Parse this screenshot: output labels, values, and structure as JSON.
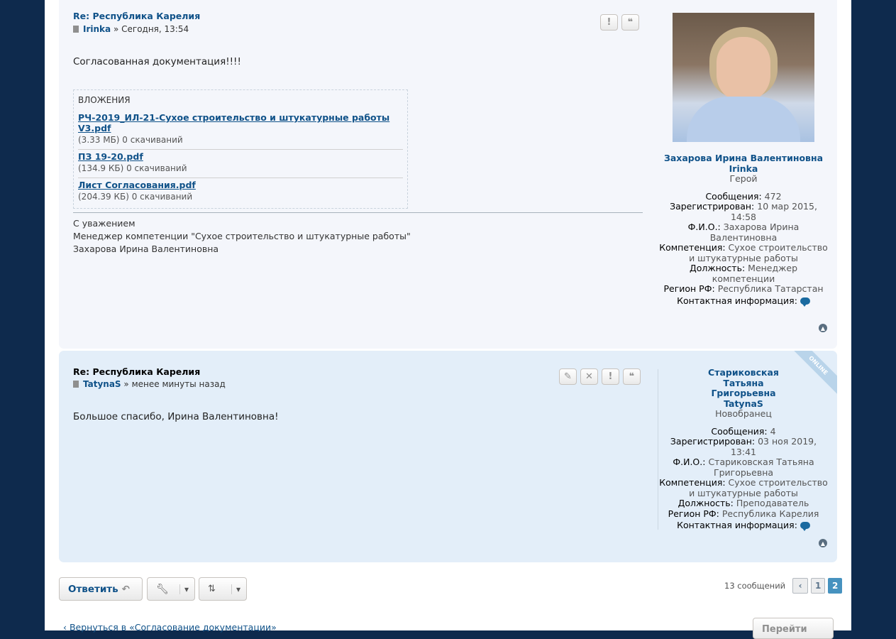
{
  "posts": [
    {
      "title": "Re: Республика Карелия",
      "author": "Irinka",
      "sep": "»",
      "time": "Сегодня, 13:54",
      "body": "Согласованная документация!!!!",
      "buttons": [
        "!",
        "❝"
      ],
      "attachments_heading": "ВЛОЖЕНИЯ",
      "attachments": [
        {
          "name": "РЧ-2019_ИЛ-21-Сухое строительство и штукатурные работы V3.pdf",
          "info": "(3.33 МБ) 0 скачиваний"
        },
        {
          "name": "ПЗ 19-20.pdf",
          "info": "(134.9 КБ) 0 скачиваний"
        },
        {
          "name": "Лист Согласования.pdf",
          "info": "(204.39 КБ) 0 скачиваний"
        }
      ],
      "signature": [
        "С уважением",
        "Менеджер компетенции \"Сухое строительство и штукатурные работы\"",
        "Захарова Ирина Валентиновна"
      ],
      "profile": {
        "fullname": "Захарова Ирина Валентиновна",
        "username": "Irinka",
        "rank": "Герой",
        "fields": [
          {
            "k": "Сообщения:",
            "v": "472"
          },
          {
            "k": "Зарегистрирован:",
            "v": "10 мар 2015, 14:58"
          },
          {
            "k": "Ф.И.О.:",
            "v": "Захарова Ирина Валентиновна"
          },
          {
            "k": "Компетенция:",
            "v": "Сухое строительство и штукатурные работы"
          },
          {
            "k": "Должность:",
            "v": "Менеджер компетенции"
          },
          {
            "k": "Регион РФ:",
            "v": "Республика Татарстан"
          }
        ],
        "contact_label": "Контактная информация:"
      }
    },
    {
      "title": "Re: Республика Карелия",
      "author": "TatynaS",
      "sep": "»",
      "time": "менее минуты назад",
      "body": "Большое спасибо, Ирина Валентиновна!",
      "buttons": [
        "✎",
        "✕",
        "!",
        "❝"
      ],
      "online_label": "ONLINE",
      "profile": {
        "fullname": "Стариковская Татьяна Григорьевна",
        "username": "TatynaS",
        "rank": "Новобранец",
        "fields": [
          {
            "k": "Сообщения:",
            "v": "4"
          },
          {
            "k": "Зарегистрирован:",
            "v": "03 ноя 2019, 13:41"
          },
          {
            "k": "Ф.И.О.:",
            "v": "Стариковская Татьяна Григорьевна"
          },
          {
            "k": "Компетенция:",
            "v": "Сухое строительство и штукатурные работы"
          },
          {
            "k": "Должность:",
            "v": "Преподаватель"
          },
          {
            "k": "Регион РФ:",
            "v": "Республика Карелия"
          }
        ],
        "contact_label": "Контактная информация:"
      }
    }
  ],
  "actions": {
    "reply_label": "Ответить",
    "reply_icon": "↶",
    "tools_icon": "wrench-icon",
    "sort_icon": "sort-icon",
    "dropdown_icon": "▾"
  },
  "pagination": {
    "count": "13 сообщений",
    "prev": "‹",
    "pages": [
      "1",
      "2"
    ],
    "current": "2"
  },
  "back_link": "‹ Вернуться в «Согласование документации»",
  "jump_label": "Перейти"
}
